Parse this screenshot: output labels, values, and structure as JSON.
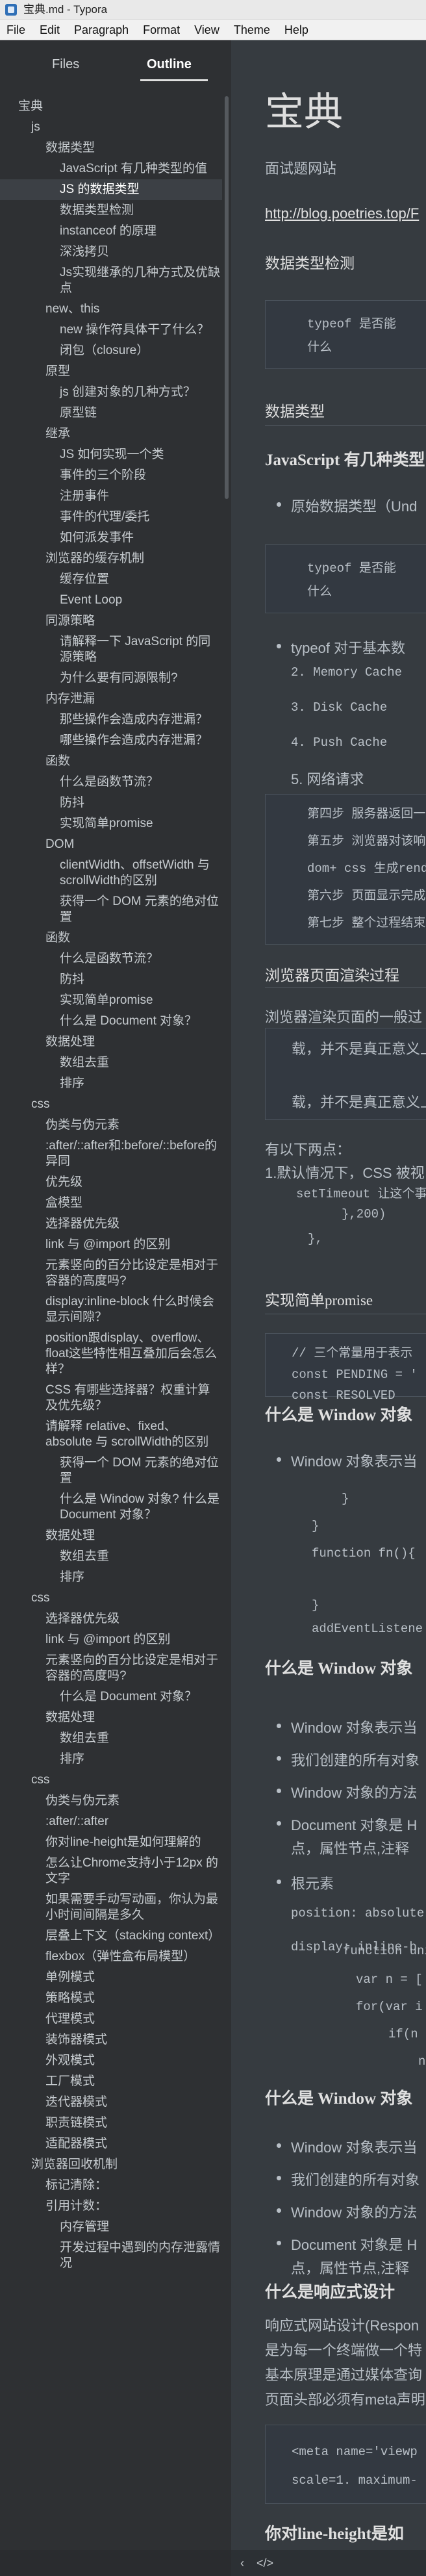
{
  "window": {
    "title": "宝典.md - Typora"
  },
  "menu": [
    "File",
    "Edit",
    "Paragraph",
    "Format",
    "View",
    "Theme",
    "Help"
  ],
  "sidebar": {
    "tabs": {
      "files": "Files",
      "outline": "Outline"
    },
    "items": [
      {
        "label": "宝典",
        "level": 0
      },
      {
        "label": "js",
        "level": 1
      },
      {
        "label": "数据类型",
        "level": 2
      },
      {
        "label": "JavaScript 有几种类型的值",
        "level": 3
      },
      {
        "label": "JS 的数据类型",
        "level": 3,
        "active": true
      },
      {
        "label": "数据类型检测",
        "level": 3
      },
      {
        "label": "instanceof 的原理",
        "level": 3
      },
      {
        "label": "深浅拷贝",
        "level": 3
      },
      {
        "label": "Js实现继承的几种方式及优缺点",
        "level": 3
      },
      {
        "label": "new、this",
        "level": 2
      },
      {
        "label": "new 操作符具体干了什么？",
        "level": 3
      },
      {
        "label": "闭包（closure）",
        "level": 3
      },
      {
        "label": "原型",
        "level": 2
      },
      {
        "label": "js 创建对象的几种方式？",
        "level": 3
      },
      {
        "label": "原型链",
        "level": 3
      },
      {
        "label": "继承",
        "level": 2
      },
      {
        "label": "JS 如何实现一个类",
        "level": 3
      },
      {
        "label": "事件的三个阶段",
        "level": 3
      },
      {
        "label": "注册事件",
        "level": 3
      },
      {
        "label": "事件的代理/委托",
        "level": 3
      },
      {
        "label": "如何派发事件",
        "level": 3
      },
      {
        "label": "浏览器的缓存机制",
        "level": 2
      },
      {
        "label": "缓存位置",
        "level": 3
      },
      {
        "label": "Event Loop",
        "level": 3
      },
      {
        "label": "同源策略",
        "level": 2
      },
      {
        "label": "请解释一下 JavaScript 的同源策略",
        "level": 3
      },
      {
        "label": "为什么要有同源限制?",
        "level": 3
      },
      {
        "label": "内存泄漏",
        "level": 2
      },
      {
        "label": "那些操作会造成内存泄漏？",
        "level": 3
      },
      {
        "label": "哪些操作会造成内存泄漏？",
        "level": 3
      },
      {
        "label": "函数",
        "level": 2
      },
      {
        "label": "什么是函数节流？",
        "level": 3
      },
      {
        "label": "防抖",
        "level": 3
      },
      {
        "label": "实现简单promise",
        "level": 3
      },
      {
        "label": "DOM",
        "level": 2
      },
      {
        "label": "clientWidth、offsetWidth 与 scrollWidth的区别",
        "level": 3
      },
      {
        "label": "获得一个 DOM 元素的绝对位置",
        "level": 3
      },
      {
        "label": "函数",
        "level": 2
      },
      {
        "label": "什么是函数节流？",
        "level": 3
      },
      {
        "label": "防抖",
        "level": 3
      },
      {
        "label": "实现简单promise",
        "level": 3
      },
      {
        "label": "什么是 Document 对象？",
        "level": 3
      },
      {
        "label": "数据处理",
        "level": 2
      },
      {
        "label": "数组去重",
        "level": 3
      },
      {
        "label": "排序",
        "level": 3
      },
      {
        "label": "css",
        "level": 1
      },
      {
        "label": "伪类与伪元素",
        "level": 2
      },
      {
        "label": ":after/::after和:before/::before的异同",
        "level": 2
      },
      {
        "label": "优先级",
        "level": 2
      },
      {
        "label": "盒模型",
        "level": 2
      },
      {
        "label": "选择器优先级",
        "level": 2
      },
      {
        "label": "link 与 @import 的区别",
        "level": 2
      },
      {
        "label": "元素竖向的百分比设定是相对于容器的高度吗?",
        "level": 2
      },
      {
        "label": "display:inline-block 什么时候会显示间隙？",
        "level": 2
      },
      {
        "label": "position跟display、overflow、float这些特性相互叠加后会怎么样？",
        "level": 2
      },
      {
        "label": "CSS 有哪些选择器？权重计算及优先级？",
        "level": 2
      },
      {
        "label": "请解释 relative、fixed、absolute 与 scrollWidth的区别",
        "level": 2
      },
      {
        "label": "获得一个 DOM 元素的绝对位置",
        "level": 3
      },
      {
        "label": "什么是 Window 对象? 什么是 Document 对象？",
        "level": 3
      },
      {
        "label": "数据处理",
        "level": 2
      },
      {
        "label": "数组去重",
        "level": 3
      },
      {
        "label": "排序",
        "level": 3
      },
      {
        "label": "css",
        "level": 1
      },
      {
        "label": "选择器优先级",
        "level": 2
      },
      {
        "label": "link 与 @import 的区别",
        "level": 2
      },
      {
        "label": "元素竖向的百分比设定是相对于容器的高度吗?",
        "level": 2
      },
      {
        "label": "什么是 Document 对象？",
        "level": 3
      },
      {
        "label": "数据处理",
        "level": 2
      },
      {
        "label": "数组去重",
        "level": 3
      },
      {
        "label": "排序",
        "level": 3
      },
      {
        "label": "css",
        "level": 1
      },
      {
        "label": "伪类与伪元素",
        "level": 2
      },
      {
        "label": ":after/::after",
        "level": 2
      },
      {
        "label": "你对line-height是如何理解的",
        "level": 2
      },
      {
        "label": "怎么让Chrome支持小于12px 的文字",
        "level": 2
      },
      {
        "label": "如果需要手动写动画，你认为最小时间间隔是多久",
        "level": 2
      },
      {
        "label": "层叠上下文（stacking context）",
        "level": 2
      },
      {
        "label": "flexbox（弹性盒布局模型）",
        "level": 2
      },
      {
        "label": "单例模式",
        "level": 2
      },
      {
        "label": "策略模式",
        "level": 2
      },
      {
        "label": "代理模式",
        "level": 2
      },
      {
        "label": "装饰器模式",
        "level": 2
      },
      {
        "label": "外观模式",
        "level": 2
      },
      {
        "label": "工厂模式",
        "level": 2
      },
      {
        "label": "迭代器模式",
        "level": 2
      },
      {
        "label": "职责链模式",
        "level": 2
      },
      {
        "label": "适配器模式",
        "level": 2
      },
      {
        "label": "浏览器回收机制",
        "level": 1
      },
      {
        "label": "标记清除：",
        "level": 2
      },
      {
        "label": "引用计数：",
        "level": 2
      },
      {
        "label": "内存管理",
        "level": 3
      },
      {
        "label": "开发过程中遇到的内存泄露情况",
        "level": 3
      }
    ]
  },
  "document": {
    "title": "宝典",
    "subtitle": "面试题网站",
    "link": "http://blog.poetries.top/F",
    "sections": [
      {
        "heading": "数据类型检测"
      },
      {
        "code": "typeof 是否能",
        "code2": "什么"
      },
      {
        "heading": "数据类型"
      },
      {
        "heading": "JavaScript 有几种类型"
      },
      {
        "bullet": "原始数据类型（Und"
      },
      {
        "code": "typeof 是否能",
        "code2": "什么"
      },
      {
        "bullet": "typeof 对于基本数"
      },
      {
        "ol": [
          "2. Memory Cache",
          "3. Disk Cache",
          "4. Push Cache",
          "5. 网络请求"
        ]
      },
      {
        "code": "第四步 服务器返回一",
        "code2": "第五步 浏览器对该响",
        "code3": "dom+ css 生成rende",
        "code4": "第六步 页面显示完成",
        "code5": "第七步 整个过程结束"
      },
      {
        "heading": "浏览器页面渲染过程"
      },
      {
        "para": "浏览器渲染页面的一般过",
        "para2": "载，并不是真正意义上"
      },
      {
        "para": "载，并不是真正意义上"
      },
      {
        "para": "有以下两点：",
        "para2": "1.默认情况下，CSS 被视"
      },
      {
        "code": "setTimeout 让这个事",
        "code2": "},200)",
        "code3": "},"
      },
      {
        "heading": "实现简单promise"
      },
      {
        "code": "// 三个常量用于表示",
        "code2": "const PENDING = '",
        "code3": "const RESOLVED"
      },
      {
        "heading": "什么是 Window 对象"
      },
      {
        "bullet": "Window 对象表示当"
      },
      {
        "code": "}",
        "code2": "}",
        "code3": "function fn(){",
        "code4": "}",
        "code5": "addEventListene"
      },
      {
        "heading": "什么是 Window 对象"
      },
      {
        "bullet": "Window 对象表示当",
        "b2": "我们创建的所有对象",
        "b3": "Window 对象的方法",
        "b4": "Document 对象是 H",
        "b4b": "点，属性节点,注释"
      },
      {
        "bullet": "根元素",
        "b2": "position: absolute",
        "b3": "display: inline-b"
      },
      {
        "code": "function unique(",
        "code2": "var n = [",
        "code3": "for(var i",
        "code4": "if(n",
        "code5": "n"
      },
      {
        "heading": "什么是 Window 对象"
      },
      {
        "bullet": "Window 对象表示当",
        "b2": "我们创建的所有对象",
        "b3": "Window 对象的方法",
        "b4": "Document 对象是 H",
        "b4b": "点，属性节点,注释"
      },
      {
        "heading": "什么是响应式设计"
      },
      {
        "para": "响应式网站设计(Respon",
        "para2": "是为每一个终端做一个特",
        "para3": "基本原理是通过媒体查询",
        "para4": "页面头部必须有meta声明"
      },
      {
        "code": "<meta name='viewp",
        "code2": "scale=1. maximum-"
      },
      {
        "heading": "你对line-height是如"
      }
    ]
  },
  "statusbar": {
    "left_icon": "‹",
    "code_icon": "</>"
  }
}
